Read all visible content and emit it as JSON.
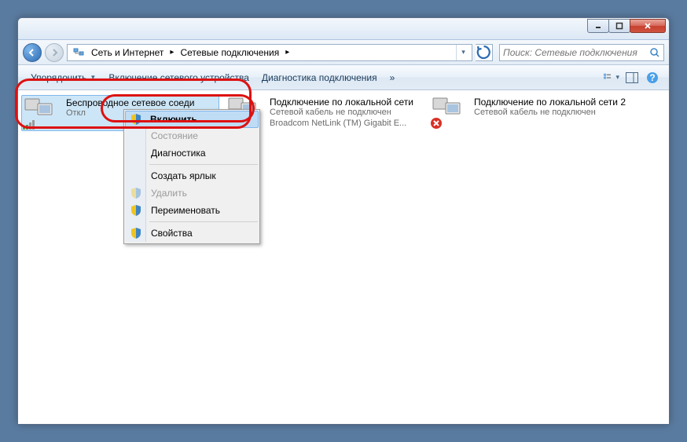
{
  "breadcrumb": {
    "parent": "Сеть и Интернет",
    "current": "Сетевые подключения"
  },
  "search": {
    "placeholder": "Поиск: Сетевые подключения"
  },
  "toolbar": {
    "organize": "Упорядочить",
    "enable_device": "Включение сетевого устройства",
    "diagnose": "Диагностика подключения",
    "more": "»"
  },
  "connections": [
    {
      "name": "Беспроводное сетевое соеди",
      "status": "Откл",
      "device": "",
      "overlay": "wifi"
    },
    {
      "name": "Подключение по локальной сети",
      "status": "Сетевой кабель не подключен",
      "device": "Broadcom NetLink (TM) Gigabit E...",
      "overlay": "plug"
    },
    {
      "name": "Подключение по локальной сети 2",
      "status": "Сетевой кабель не подключен",
      "device": "",
      "overlay": "red-x"
    }
  ],
  "context_menu": {
    "enable": "Включить",
    "status": "Состояние",
    "diagnostics": "Диагностика",
    "create_shortcut": "Создать ярлык",
    "delete": "Удалить",
    "rename": "Переименовать",
    "properties": "Свойства"
  }
}
